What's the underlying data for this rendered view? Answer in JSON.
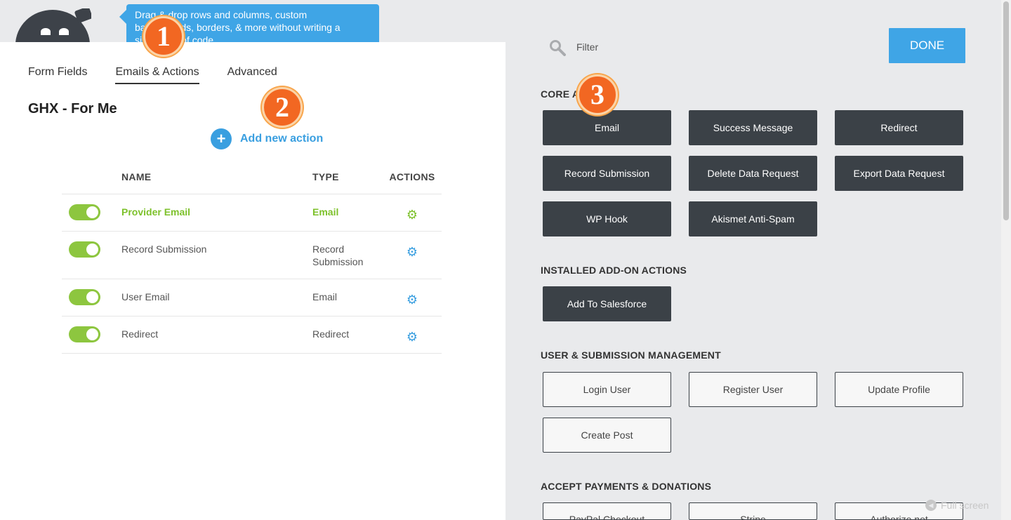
{
  "tooltip": {
    "line1": "Drag & drop rows and columns, custom",
    "line2": "backgrounds, borders, & more without writing a",
    "line3": "single line of code."
  },
  "badges": {
    "b1": "1",
    "b2": "2",
    "b3": "3"
  },
  "tabs": [
    {
      "label": "Form Fields"
    },
    {
      "label": "Emails & Actions"
    },
    {
      "label": "Advanced"
    }
  ],
  "form_title": "GHX - For Me",
  "add_action_label": "Add new action",
  "table": {
    "headers": {
      "name": "NAME",
      "type": "TYPE",
      "actions": "ACTIONS"
    },
    "rows": [
      {
        "name": "Provider Email",
        "type": "Email",
        "enabled": true
      },
      {
        "name": "Record Submission",
        "type": "Record Submission",
        "enabled": true
      },
      {
        "name": "User Email",
        "type": "Email",
        "enabled": true
      },
      {
        "name": "Redirect",
        "type": "Redirect",
        "enabled": true
      }
    ]
  },
  "filter": {
    "placeholder": "Filter"
  },
  "done_label": "DONE",
  "sections": {
    "core": {
      "title": "CORE ACTIONS",
      "buttons": [
        "Email",
        "Success Message",
        "Redirect",
        "Record Submission",
        "Delete Data Request",
        "Export Data Request",
        "WP Hook",
        "Akismet Anti-Spam"
      ]
    },
    "addons": {
      "title": "INSTALLED ADD-ON ACTIONS",
      "buttons": [
        "Add To Salesforce"
      ]
    },
    "user": {
      "title": "USER & SUBMISSION MANAGEMENT",
      "buttons": [
        "Login User",
        "Register User",
        "Update Profile",
        "Create Post"
      ]
    },
    "payments": {
      "title": "ACCEPT PAYMENTS & DONATIONS",
      "buttons": [
        "PayPal Checkout",
        "Stripe",
        "Authorize.net"
      ]
    }
  },
  "fullscreen_label": "Full screen",
  "colors": {
    "accent": "#3fa5e6",
    "toggle_on": "#8dc63f",
    "dark_button": "#3b4147",
    "badge": "#f26722"
  }
}
